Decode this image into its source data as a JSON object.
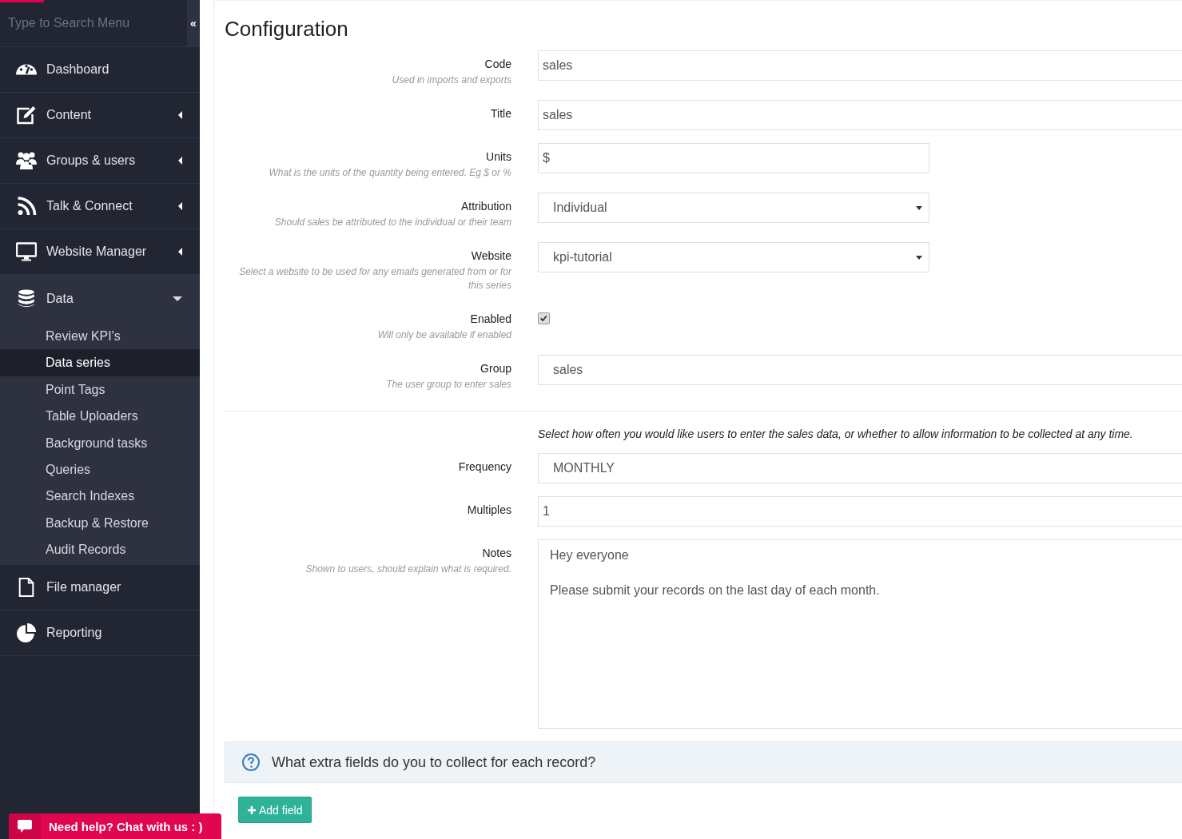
{
  "sidebar": {
    "search_placeholder": "Type to Search Menu",
    "collapse_glyph": "«",
    "items": [
      {
        "label": "Dashboard",
        "expandable": false,
        "expanded": false
      },
      {
        "label": "Content",
        "expandable": true,
        "expanded": false
      },
      {
        "label": "Groups & users",
        "expandable": true,
        "expanded": false
      },
      {
        "label": "Talk & Connect",
        "expandable": true,
        "expanded": false
      },
      {
        "label": "Website Manager",
        "expandable": true,
        "expanded": false
      },
      {
        "label": "Data",
        "expandable": true,
        "expanded": true,
        "children": [
          {
            "label": "Review KPI's",
            "selected": false
          },
          {
            "label": "Data series",
            "selected": true
          },
          {
            "label": "Point Tags",
            "selected": false
          },
          {
            "label": "Table Uploaders",
            "selected": false
          },
          {
            "label": "Background tasks",
            "selected": false
          },
          {
            "label": "Queries",
            "selected": false
          },
          {
            "label": "Search Indexes",
            "selected": false
          },
          {
            "label": "Backup & Restore",
            "selected": false
          },
          {
            "label": "Audit Records",
            "selected": false
          }
        ]
      },
      {
        "label": "File manager",
        "expandable": false,
        "expanded": false
      },
      {
        "label": "Reporting",
        "expandable": false,
        "expanded": false
      }
    ]
  },
  "chat": {
    "label": "Need help? Chat with us : )"
  },
  "heading": "Configuration",
  "sections": [
    {
      "fields": [
        {
          "kind": "text",
          "label": "Code",
          "hint": "Used in imports and exports",
          "value": "sales"
        },
        {
          "kind": "text",
          "label": "Title",
          "value": "sales"
        },
        {
          "kind": "shorttext",
          "label": "Units",
          "hint": "What is the units of the quantity being entered. Eg $ or %",
          "value": "$"
        },
        {
          "kind": "select",
          "label": "Attribution",
          "hint": "Should sales be attributed to the individual or their team",
          "value": "Individual"
        },
        {
          "kind": "select",
          "label": "Website",
          "hint": "Select a website to be used for any emails generated from or for this series",
          "value": "kpi-tutorial"
        },
        {
          "kind": "checkbox",
          "label": "Enabled",
          "hint": "Will only be available if enabled",
          "checked": true
        },
        {
          "kind": "wideselect",
          "label": "Group",
          "hint": "The user group to enter sales",
          "value": "sales"
        }
      ]
    },
    {
      "intro": "Select how often you would like users to enter the sales data, or whether to allow information to be collected at any time.",
      "fields": [
        {
          "kind": "wideselect",
          "label": "Frequency",
          "value": "MONTHLY"
        },
        {
          "kind": "text",
          "label": "Multiples",
          "value": "1"
        },
        {
          "kind": "textarea",
          "label": "Notes",
          "hint": "Shown to users, should explain what is required.",
          "value": "Hey everyone\n\nPlease submit your records on the last day of each month."
        }
      ]
    }
  ],
  "extra_panel": {
    "question": "What extra fields do you to collect for each record?",
    "button": "Add field"
  }
}
